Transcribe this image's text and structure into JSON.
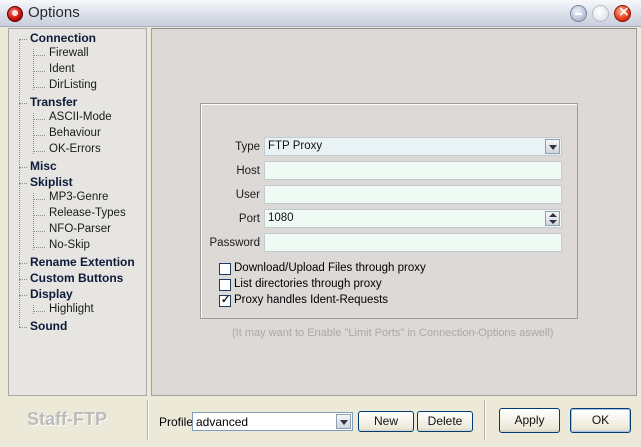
{
  "window": {
    "title": "Options"
  },
  "tree": {
    "items": [
      {
        "label": "Connection",
        "level": 0
      },
      {
        "label": "Firewall",
        "level": 1,
        "selected": true
      },
      {
        "label": "Ident",
        "level": 1
      },
      {
        "label": "DirListing",
        "level": 1
      },
      {
        "label": "Transfer",
        "level": 0
      },
      {
        "label": "ASCII-Mode",
        "level": 1
      },
      {
        "label": "Behaviour",
        "level": 1
      },
      {
        "label": "OK-Errors",
        "level": 1
      },
      {
        "label": "Misc",
        "level": 0
      },
      {
        "label": "Skiplist",
        "level": 0
      },
      {
        "label": "MP3-Genre",
        "level": 1
      },
      {
        "label": "Release-Types",
        "level": 1
      },
      {
        "label": "NFO-Parser",
        "level": 1
      },
      {
        "label": "No-Skip",
        "level": 1
      },
      {
        "label": "Rename Extention",
        "level": 0
      },
      {
        "label": "Custom Buttons",
        "level": 0
      },
      {
        "label": "Display",
        "level": 0
      },
      {
        "label": "Highlight",
        "level": 1
      },
      {
        "label": "Sound",
        "level": 0
      }
    ]
  },
  "form": {
    "type_label": "Type",
    "type_value": "FTP Proxy",
    "host_label": "Host",
    "host_value": "",
    "user_label": "User",
    "user_value": "",
    "port_label": "Port",
    "port_value": "1080",
    "password_label": "Password",
    "password_value": "",
    "checkboxes": [
      {
        "label": "Download/Upload Files through proxy",
        "checked": false
      },
      {
        "label": "List directories through proxy",
        "checked": false
      },
      {
        "label": "Proxy handles Ident-Requests",
        "checked": true
      }
    ],
    "note": "(It may want to Enable \"Limit Ports\" in Connection-Options aswell)"
  },
  "footer": {
    "brand": "Staff-FTP",
    "profile_label": "Profile",
    "profile_value": "advanced",
    "new_label": "New",
    "delete_label": "Delete",
    "apply_label": "Apply",
    "ok_label": "OK"
  },
  "colors": {
    "field_bg": "#effaf4",
    "panel_bg": "#dcd9d7",
    "dialog_bg": "#ece9d8"
  }
}
